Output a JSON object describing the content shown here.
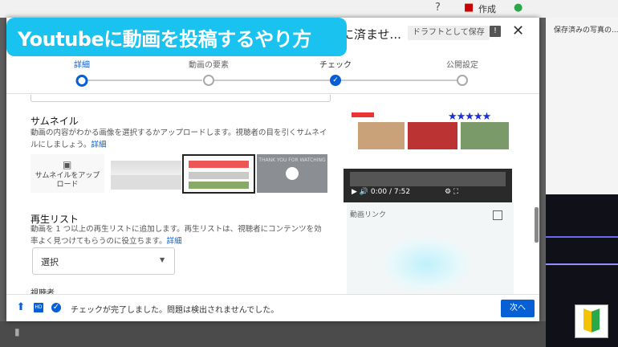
{
  "banner": {
    "text": "Youtubeに動画を投稿するやり方"
  },
  "background": {
    "create_label": "作成",
    "saved_item": "保存済みの写真の..."
  },
  "dialog": {
    "title": "に済ませ...",
    "draft_label": "ドラフトとして保存",
    "close_label": "✕",
    "alert_label": "!"
  },
  "stepper": {
    "steps": [
      {
        "label": "詳細",
        "state": "current"
      },
      {
        "label": "動画の要素",
        "state": "todo"
      },
      {
        "label": "チェック",
        "state": "done"
      },
      {
        "label": "公開設定",
        "state": "todo"
      }
    ],
    "done_mark": "✓"
  },
  "thumbnail": {
    "title": "サムネイル",
    "desc": "動画の内容がわかる画像を選択するかアップロードします。視聴者の目を引くサムネイルにしましょう。",
    "more": "詳細",
    "upload_label": "サムネイルをアップロード",
    "upload_icon": "image-plus-icon",
    "thumb3_text": "THANK YOU FOR WATCHING"
  },
  "playlist": {
    "title": "再生リスト",
    "desc": "動画を 1 つ以上の再生リストに追加します。再生リストは、視聴者にコンテンツを効率よく見つけてもらうのに役立ちます。",
    "more": "詳細",
    "select_value": "選択",
    "select_arrow": "▼"
  },
  "cut_section_title": "視聴者",
  "preview": {
    "stars": "★★★★★",
    "time": "0:00 / 7:52",
    "play_icon": "▶",
    "volume_icon": "🔊",
    "settings_icon": "⚙",
    "fullscreen_icon": "⛶",
    "link_label": "動画リンク"
  },
  "footer": {
    "upload_icon": "⬆",
    "hd_label": "HD",
    "check_icon": "✓",
    "message": "チェックが完了しました。問題は検出されませんでした。",
    "next_label": "次へ"
  },
  "colors": {
    "accent": "#065fd4",
    "banner": "#19c2ef",
    "stars": "#1b2fd6"
  }
}
